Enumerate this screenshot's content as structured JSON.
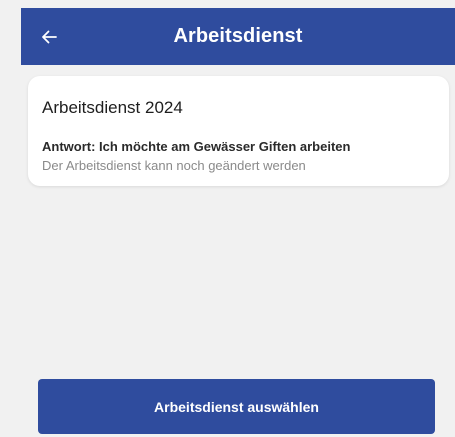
{
  "app_bar": {
    "title": "Arbeitsdienst",
    "background_color": "#2f4c9e",
    "back_icon": "arrow-left-icon"
  },
  "card": {
    "title": "Arbeitsdienst 2024",
    "answer": "Antwort: Ich möchte am Gewässer Giften arbeiten",
    "note": "Der Arbeitsdienst kann noch geändert werden"
  },
  "footer": {
    "button_label": "Arbeitsdienst auswählen",
    "button_color": "#2f4c9e"
  }
}
